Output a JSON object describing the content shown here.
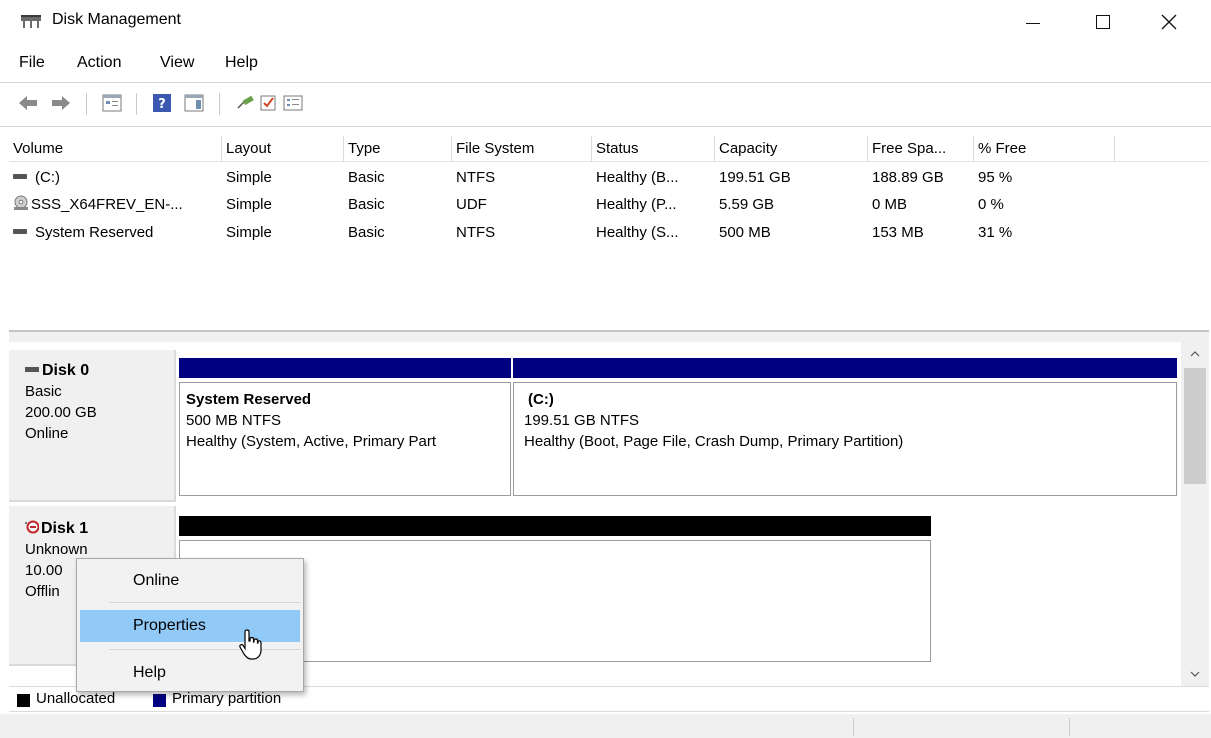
{
  "window": {
    "title": "Disk Management"
  },
  "menu": [
    "File",
    "Action",
    "View",
    "Help"
  ],
  "volume_list": {
    "columns": [
      "Volume",
      "Layout",
      "Type",
      "File System",
      "Status",
      "Capacity",
      "Free Spa...",
      "% Free"
    ],
    "rows": [
      {
        "volume": "(C:)",
        "layout": "Simple",
        "type": "Basic",
        "file_system": "NTFS",
        "status": "Healthy (B...",
        "capacity": "199.51 GB",
        "free_space": "188.89 GB",
        "percent_free": "95 %",
        "icon": "drive-icon"
      },
      {
        "volume": "SSS_X64FREV_EN-...",
        "layout": "Simple",
        "type": "Basic",
        "file_system": "UDF",
        "status": "Healthy (P...",
        "capacity": "5.59 GB",
        "free_space": "0 MB",
        "percent_free": "0 %",
        "icon": "cd-drive-icon"
      },
      {
        "volume": "System Reserved",
        "layout": "Simple",
        "type": "Basic",
        "file_system": "NTFS",
        "status": "Healthy (S...",
        "capacity": "500 MB",
        "free_space": "153 MB",
        "percent_free": "31 %",
        "icon": "drive-icon"
      }
    ]
  },
  "disks": [
    {
      "name": "Disk 0",
      "type": "Basic",
      "size": "200.00 GB",
      "state": "Online",
      "partitions": [
        {
          "title": "System Reserved",
          "size": "500 MB NTFS",
          "status": "Healthy (System, Active, Primary Part"
        },
        {
          "title": "(C:)",
          "size": "199.51 GB NTFS",
          "status": "Healthy (Boot, Page File, Crash Dump, Primary Partition)"
        }
      ]
    },
    {
      "name": "Disk 1",
      "type": "Unknown",
      "size": "10.00",
      "state": "Offlin"
    }
  ],
  "context_menu": {
    "items": [
      "Online",
      "Properties",
      "Help"
    ],
    "hovered": "Properties"
  },
  "legend": {
    "items": [
      {
        "label": "Unallocated",
        "color": "#000000"
      },
      {
        "label": "Primary partition",
        "color": "#000080"
      }
    ]
  },
  "colors": {
    "primary_partition": "#000080",
    "unallocated": "#000000",
    "menu_hover": "#91c9f7"
  }
}
